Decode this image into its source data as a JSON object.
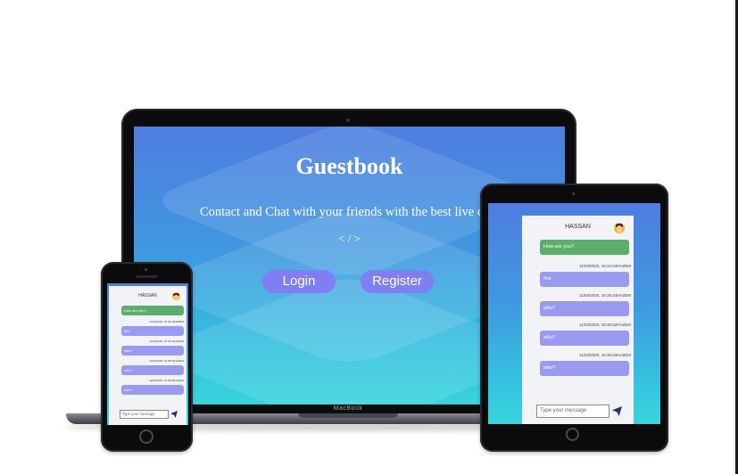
{
  "laptop": {
    "brand": "MacBook",
    "hero_title": "Guestbook",
    "hero_subtitle": "Contact and Chat with your friends with the best live chat",
    "hero_code": "< / >",
    "login_label": "Login",
    "register_label": "Register"
  },
  "chat": {
    "header_name": "HASSAN",
    "first_message": "How are you?",
    "messages": [
      {
        "meta": "11/04/2020, 16:34:34HAZEM",
        "text": "fine"
      },
      {
        "meta": "11/04/2020, 16:35:44HAZEM",
        "text": "wbu?"
      },
      {
        "meta": "11/04/2020, 16:35:52HAZEM",
        "text": "wbu?"
      },
      {
        "meta": "11/04/2020, 16:35:53HAZEM",
        "text": "wbu?"
      }
    ],
    "input_placeholder": "Type your message",
    "send_icon": "paper-plane-icon"
  },
  "colors": {
    "gradient_top": "#4e7de0",
    "gradient_bottom": "#38d4dc",
    "button": "#7f7ef2",
    "own_bubble": "#5cae6a",
    "other_bubble": "#9a9af0"
  }
}
